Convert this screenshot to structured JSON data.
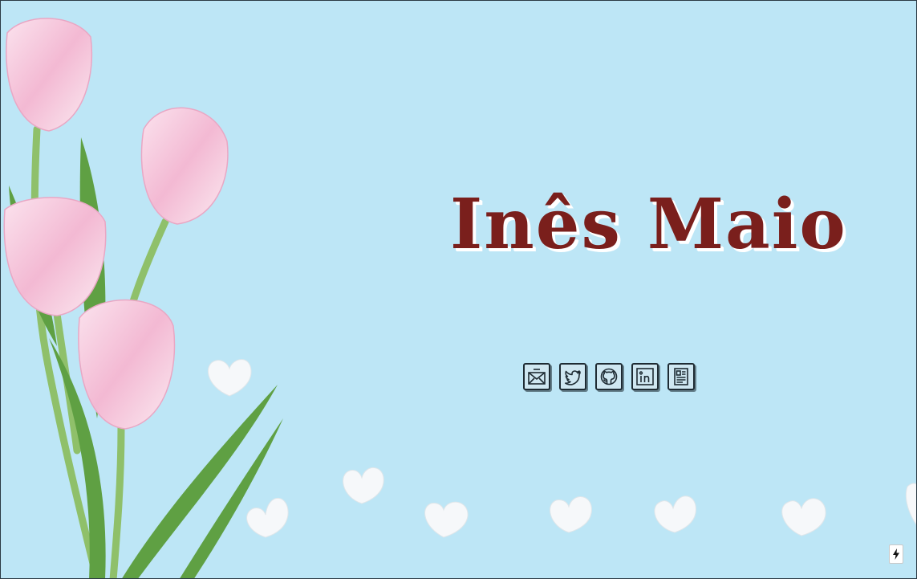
{
  "header": {
    "title": "Inês Maio"
  },
  "social_links": [
    {
      "name": "email-icon"
    },
    {
      "name": "twitter-icon"
    },
    {
      "name": "github-icon"
    },
    {
      "name": "linkedin-icon"
    },
    {
      "name": "resume-icon"
    }
  ],
  "corner_badge": {
    "icon": "lightning-bolt-icon"
  },
  "colors": {
    "background": "#bde6f6",
    "title": "#7a1f1c",
    "icon_stroke": "#1e2b33"
  }
}
